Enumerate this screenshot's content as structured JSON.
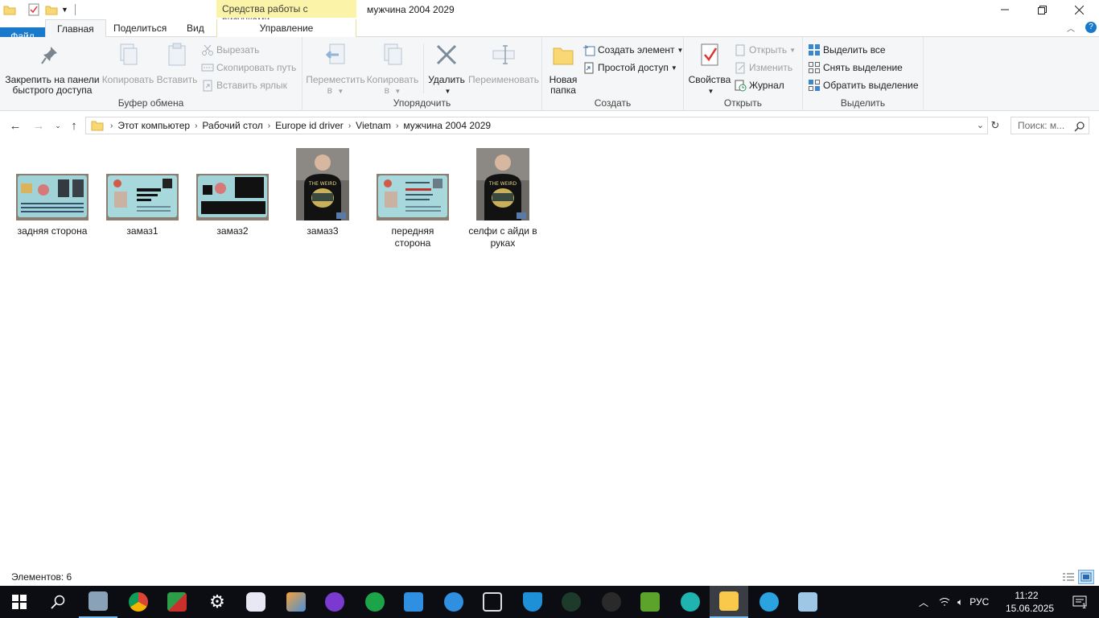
{
  "window": {
    "title": "мужчина 2004 2029",
    "context_tab_header": "Средства работы с рисунками"
  },
  "tabs": {
    "file": "Файл",
    "home": "Главная",
    "share": "Поделиться",
    "view": "Вид",
    "manage": "Управление"
  },
  "ribbon": {
    "clipboard": {
      "label": "Буфер обмена",
      "pin": "Закрепить на панели быстрого доступа",
      "copy": "Копировать",
      "paste": "Вставить",
      "cut": "Вырезать",
      "copy_path": "Скопировать путь",
      "paste_shortcut": "Вставить ярлык"
    },
    "organize": {
      "label": "Упорядочить",
      "move_to": "Переместить в",
      "copy_to": "Копировать в",
      "delete": "Удалить",
      "rename": "Переименовать"
    },
    "create": {
      "label": "Создать",
      "new_folder": "Новая папка",
      "new_item": "Создать элемент",
      "easy_access": "Простой доступ"
    },
    "open": {
      "label": "Открыть",
      "properties": "Свойства",
      "open": "Открыть",
      "edit": "Изменить",
      "history": "Журнал"
    },
    "select": {
      "label": "Выделить",
      "select_all": "Выделить все",
      "select_none": "Снять выделение",
      "invert": "Обратить выделение"
    }
  },
  "address": {
    "crumbs": [
      "Этот компьютер",
      "Рабочий стол",
      "Europe id driver",
      "Vietnam",
      "мужчина 2004 2029"
    ],
    "search_placeholder": "Поиск: м..."
  },
  "files": [
    {
      "name": "задняя сторона",
      "kind": "id-back"
    },
    {
      "name": "замаз1",
      "kind": "id-front-redacted"
    },
    {
      "name": "замаз2",
      "kind": "id-back-redacted"
    },
    {
      "name": "замаз3",
      "kind": "selfie"
    },
    {
      "name": "передняя сторона",
      "kind": "id-front"
    },
    {
      "name": "селфи с айди в руках",
      "kind": "selfie"
    }
  ],
  "status": {
    "items_count": "Элементов: 6"
  },
  "taskbar": {
    "language": "РУС",
    "time": "11:22",
    "date": "15.06.2025",
    "notification_count": "1"
  }
}
